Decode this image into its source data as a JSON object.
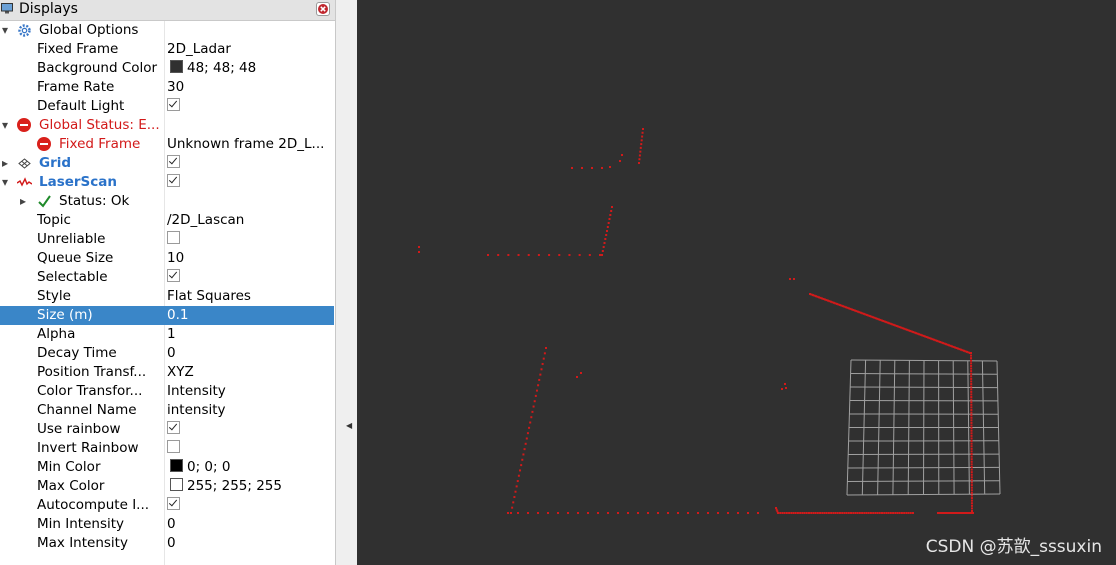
{
  "panel": {
    "title": "Displays",
    "rows": [
      {
        "depth": 0,
        "arrow": "open",
        "icon": "gear-icon",
        "label": "Global Options",
        "value": "",
        "style": ""
      },
      {
        "depth": 1,
        "arrow": "",
        "icon": "",
        "label": "Fixed Frame",
        "value": "2D_Ladar",
        "style": ""
      },
      {
        "depth": 1,
        "arrow": "",
        "icon": "",
        "label": "Background Color",
        "value": "48; 48; 48",
        "swatch": "#303030",
        "style": ""
      },
      {
        "depth": 1,
        "arrow": "",
        "icon": "",
        "label": "Frame Rate",
        "value": "30",
        "style": ""
      },
      {
        "depth": 1,
        "arrow": "",
        "icon": "",
        "label": "Default Light",
        "check": true,
        "style": ""
      },
      {
        "depth": 0,
        "arrow": "open",
        "icon": "error-icon",
        "label": "Global Status: E...",
        "value": "",
        "style": "red"
      },
      {
        "depth": 1,
        "arrow": "",
        "icon": "error-icon",
        "label": "Fixed Frame",
        "value": "Unknown frame 2D_L...",
        "style": "red"
      },
      {
        "depth": 0,
        "arrow": "closed",
        "icon": "grid-icon",
        "label": "Grid",
        "check": true,
        "style": "blue"
      },
      {
        "depth": 0,
        "arrow": "open",
        "icon": "laserscan-icon",
        "label": "LaserScan",
        "check": true,
        "style": "blue"
      },
      {
        "depth": 1,
        "arrow": "closed",
        "icon": "ok-check-icon",
        "label": "Status: Ok",
        "value": "",
        "style": ""
      },
      {
        "depth": 1,
        "arrow": "",
        "icon": "",
        "label": "Topic",
        "value": "/2D_Lascan",
        "style": ""
      },
      {
        "depth": 1,
        "arrow": "",
        "icon": "",
        "label": "Unreliable",
        "check": false,
        "style": ""
      },
      {
        "depth": 1,
        "arrow": "",
        "icon": "",
        "label": "Queue Size",
        "value": "10",
        "style": ""
      },
      {
        "depth": 1,
        "arrow": "",
        "icon": "",
        "label": "Selectable",
        "check": true,
        "style": ""
      },
      {
        "depth": 1,
        "arrow": "",
        "icon": "",
        "label": "Style",
        "value": "Flat Squares",
        "style": ""
      },
      {
        "depth": 1,
        "arrow": "",
        "icon": "",
        "label": "Size (m)",
        "value": "0.1",
        "style": "",
        "selected": true
      },
      {
        "depth": 1,
        "arrow": "",
        "icon": "",
        "label": "Alpha",
        "value": "1",
        "style": ""
      },
      {
        "depth": 1,
        "arrow": "",
        "icon": "",
        "label": "Decay Time",
        "value": "0",
        "style": ""
      },
      {
        "depth": 1,
        "arrow": "",
        "icon": "",
        "label": "Position Transf...",
        "value": "XYZ",
        "style": ""
      },
      {
        "depth": 1,
        "arrow": "",
        "icon": "",
        "label": "Color Transfor...",
        "value": "Intensity",
        "style": ""
      },
      {
        "depth": 1,
        "arrow": "",
        "icon": "",
        "label": "Channel Name",
        "value": "intensity",
        "style": ""
      },
      {
        "depth": 1,
        "arrow": "",
        "icon": "",
        "label": "Use rainbow",
        "check": true,
        "style": ""
      },
      {
        "depth": 1,
        "arrow": "",
        "icon": "",
        "label": "Invert Rainbow",
        "check": false,
        "style": ""
      },
      {
        "depth": 1,
        "arrow": "",
        "icon": "",
        "label": "Min Color",
        "value": "0; 0; 0",
        "swatch": "#000000",
        "style": ""
      },
      {
        "depth": 1,
        "arrow": "",
        "icon": "",
        "label": "Max Color",
        "value": "255; 255; 255",
        "swatch": "#ffffff",
        "style": ""
      },
      {
        "depth": 1,
        "arrow": "",
        "icon": "",
        "label": "Autocompute I...",
        "check": true,
        "style": ""
      },
      {
        "depth": 1,
        "arrow": "",
        "icon": "",
        "label": "Min Intensity",
        "value": "0",
        "style": ""
      },
      {
        "depth": 1,
        "arrow": "",
        "icon": "",
        "label": "Max Intensity",
        "value": "0",
        "style": ""
      }
    ]
  },
  "viewport": {
    "background": "#303030",
    "scan_color": "#d11a1a",
    "grid_color": "#a0a0a0",
    "watermark": "CSDN @苏歆_sssuxin"
  }
}
